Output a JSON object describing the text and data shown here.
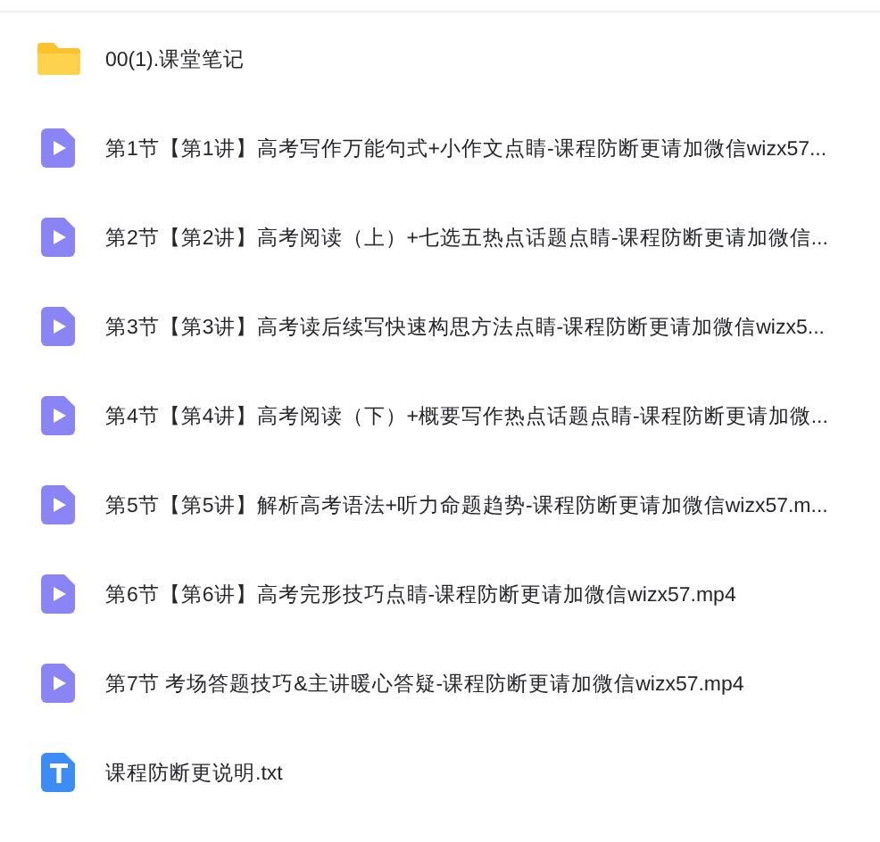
{
  "files": [
    {
      "kind": "folder",
      "name": "00(1).课堂笔记"
    },
    {
      "kind": "video",
      "name": "第1节【第1讲】高考写作万能句式+小作文点睛-课程防断更请加微信wizx57..."
    },
    {
      "kind": "video",
      "name": "第2节【第2讲】高考阅读（上）+七选五热点话题点睛-课程防断更请加微信..."
    },
    {
      "kind": "video",
      "name": "第3节【第3讲】高考读后续写快速构思方法点睛-课程防断更请加微信wizx5..."
    },
    {
      "kind": "video",
      "name": "第4节【第4讲】高考阅读（下）+概要写作热点话题点睛-课程防断更请加微..."
    },
    {
      "kind": "video",
      "name": "第5节【第5讲】解析高考语法+听力命题趋势-课程防断更请加微信wizx57.m..."
    },
    {
      "kind": "video",
      "name": "第6节【第6讲】高考完形技巧点睛-课程防断更请加微信wizx57.mp4"
    },
    {
      "kind": "video",
      "name": "第7节 考场答题技巧&主讲暖心答疑-课程防断更请加微信wizx57.mp4"
    },
    {
      "kind": "text",
      "name": "课程防断更说明.txt"
    }
  ]
}
